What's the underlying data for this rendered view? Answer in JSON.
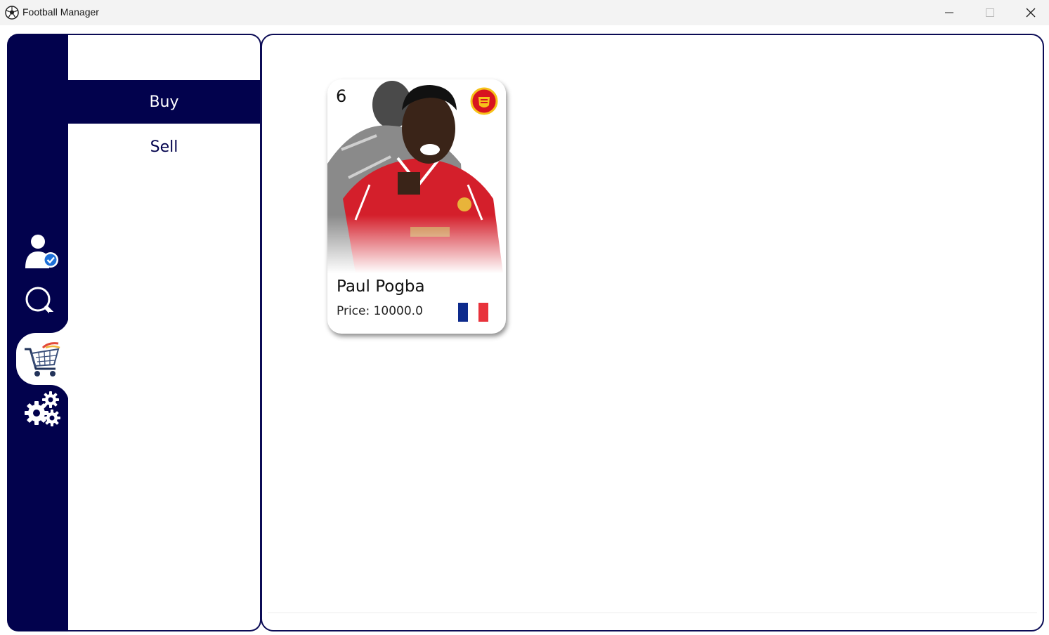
{
  "window": {
    "title": "Football Manager",
    "app_icon": "soccer-ball-icon"
  },
  "nav_rail": {
    "items": [
      {
        "name": "user-verified-icon",
        "active": false
      },
      {
        "name": "search-icon",
        "active": false
      },
      {
        "name": "shopping-cart-icon",
        "active": true
      },
      {
        "name": "gears-icon",
        "active": false
      }
    ]
  },
  "submenu": {
    "buy_label": "Buy",
    "sell_label": "Sell",
    "selected": "Buy"
  },
  "market": {
    "cards": [
      {
        "number": "6",
        "name": "Paul Pogba",
        "price_text": "Price: 10000.0",
        "club_badge": "manchester-united-crest-icon",
        "nation_flag": "france-flag-icon",
        "flag_colors": [
          "#0d2a8c",
          "#ffffff",
          "#e8323b"
        ]
      }
    ]
  },
  "colors": {
    "primary": "#02024d",
    "accent": "#1d6fd8"
  }
}
